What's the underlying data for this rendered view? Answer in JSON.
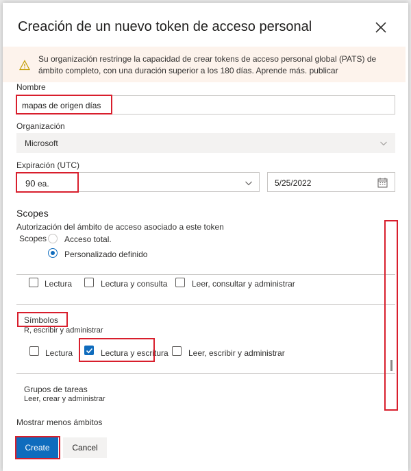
{
  "dialog": {
    "title": "Creación de un nuevo token de acceso personal",
    "close_icon": "close-icon"
  },
  "banner": {
    "icon": "warning-icon",
    "text": "Su organización restringe la capacidad de crear tokens de acceso personal global (PATS) de ámbito completo, con una duración superior a los 180 días. Aprende más. publicar"
  },
  "name": {
    "label": "Nombre",
    "value": "mapas de origen días"
  },
  "organization": {
    "label": "Organización",
    "value": "Microsoft"
  },
  "expiration": {
    "label": "Expiración (UTC)",
    "duration_value": "90",
    "duration_unit": "ea.",
    "date_value": "5/25/2022",
    "calendar_icon": "calendar-icon"
  },
  "scopes": {
    "heading": "Scopes",
    "description": "Autorización del ámbito de acceso asociado a este token",
    "radio_label": "Scopes",
    "option_full": "Acceso total.",
    "option_custom": "Personalizado definido",
    "selected": "custom"
  },
  "row_top": {
    "options": [
      "Lectura",
      "Lectura y consulta",
      "Leer, consultar y administrar"
    ]
  },
  "symbols": {
    "title": "Símbolos",
    "subtitle": "R, escribir y administrar",
    "options": [
      "Lectura",
      "Lectura y escritura",
      "Leer, escribir y administrar"
    ],
    "checked_index": 1
  },
  "task_groups": {
    "title": "Grupos de tareas",
    "subtitle": "Leer, crear y administrar"
  },
  "show_less": "Mostrar menos ámbitos",
  "footer": {
    "create": "Create",
    "cancel": "Cancel"
  },
  "colors": {
    "accent": "#0f6cbd",
    "annotation": "#d81e2c",
    "banner_bg": "#fdf3ec",
    "warning": "#c19c00"
  }
}
